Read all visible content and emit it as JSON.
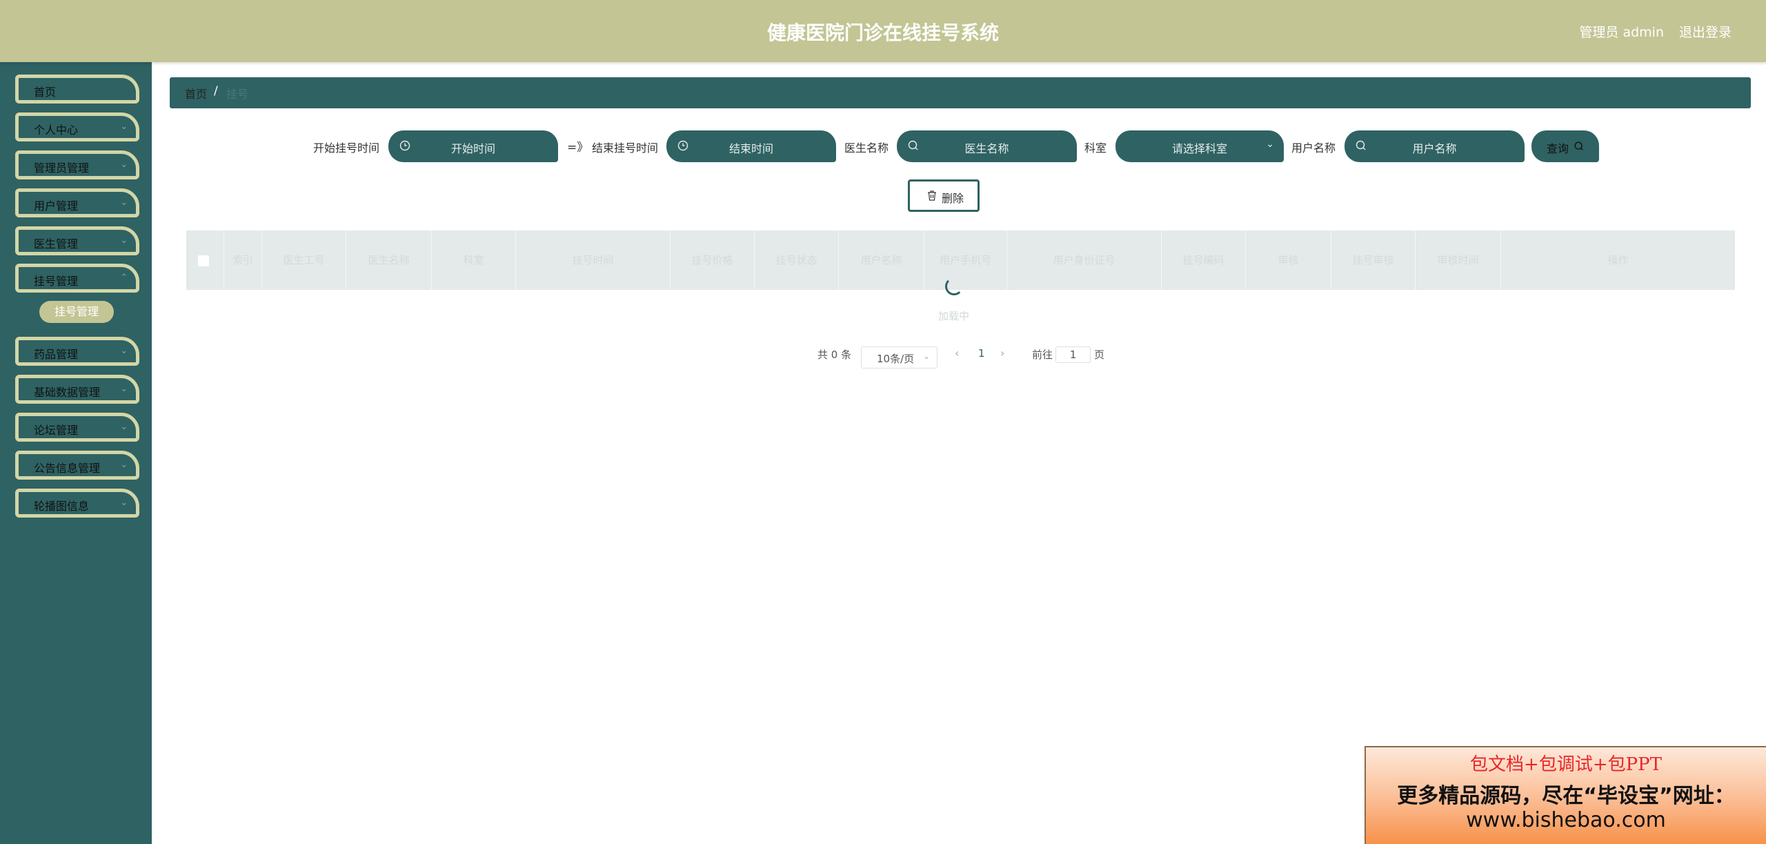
{
  "header": {
    "title": "健康医院门诊在线挂号系统",
    "admin": "管理员 admin",
    "logout": "退出登录"
  },
  "sidebar": {
    "items": [
      {
        "label": "首页",
        "has_arrow": false
      },
      {
        "label": "个人中心",
        "has_arrow": true
      },
      {
        "label": "管理员管理",
        "has_arrow": true
      },
      {
        "label": "用户管理",
        "has_arrow": true
      },
      {
        "label": "医生管理",
        "has_arrow": true
      },
      {
        "label": "挂号管理",
        "has_arrow": true
      },
      {
        "label": "药品管理",
        "has_arrow": true
      },
      {
        "label": "基础数据管理",
        "has_arrow": true
      },
      {
        "label": "论坛管理",
        "has_arrow": true
      },
      {
        "label": "公告信息管理",
        "has_arrow": true
      },
      {
        "label": "轮播图信息",
        "has_arrow": true
      }
    ],
    "submenu": "挂号管理"
  },
  "breadcrumb": {
    "home": "首页",
    "separator": "/",
    "current": "挂号"
  },
  "search": {
    "start_label": "开始挂号时间",
    "start_placeholder": "开始时间",
    "range_sep": "=》",
    "end_label": "结束挂号时间",
    "end_placeholder": "结束时间",
    "doctor_label": "医生名称",
    "doctor_placeholder": "医生名称",
    "dept_label": "科室",
    "dept_placeholder": "请选择科室",
    "user_label": "用户名称",
    "user_placeholder": "用户名称",
    "query": "查询"
  },
  "actions": {
    "delete": "删除"
  },
  "table": {
    "columns": [
      "索引",
      "医生工号",
      "医生名称",
      "科室",
      "挂号时间",
      "挂号价格",
      "挂号状态",
      "用户名称",
      "用户手机号",
      "用户身份证号",
      "挂号编码",
      "审核",
      "挂号审核",
      "审核时间",
      "操作"
    ],
    "loading_text": "加载中"
  },
  "pagination": {
    "total": "共 0 条",
    "page_size": "10条/页",
    "prev": "‹",
    "current": "1",
    "next": "›",
    "goto_label": "前往",
    "goto_value": "1",
    "page_suffix": "页"
  },
  "banner": {
    "line1": "包文档+包调试+包PPT",
    "line2": "更多精品源码，尽在“毕设宝”网址：",
    "line3": "www.bishebao.com"
  },
  "colors": {
    "header": "#c3c594",
    "sidebar": "#2f6263",
    "accent": "#2f6263"
  }
}
